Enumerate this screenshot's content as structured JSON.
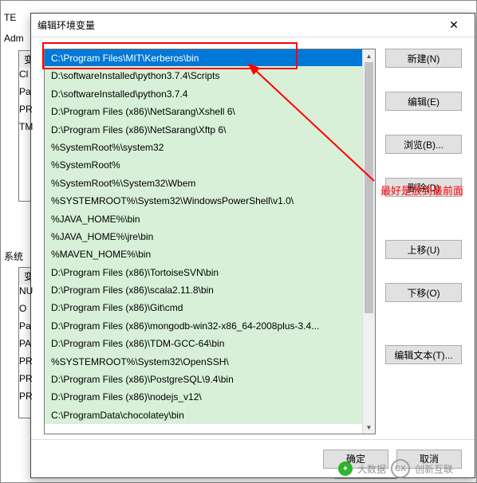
{
  "bg": {
    "label_admin": "Adm",
    "label_te": "TE",
    "label_var1": "变",
    "rows1": [
      "Cl",
      "Pa",
      "PR",
      "TM"
    ],
    "label_sys": "系统",
    "label_var2": "变",
    "rows2": [
      "NU",
      "O",
      "Pa",
      "PA",
      "PR",
      "PR",
      "PR"
    ],
    "ok": "确定"
  },
  "dialog": {
    "title": "编辑环境变量",
    "close": "✕",
    "items": [
      "C:\\Program Files\\MIT\\Kerberos\\bin",
      "D:\\softwareInstalled\\python3.7.4\\Scripts",
      "D:\\softwareInstalled\\python3.7.4",
      "D:\\Program Files (x86)\\NetSarang\\Xshell 6\\",
      "D:\\Program Files (x86)\\NetSarang\\Xftp 6\\",
      "%SystemRoot%\\system32",
      "%SystemRoot%",
      "%SystemRoot%\\System32\\Wbem",
      "%SYSTEMROOT%\\System32\\WindowsPowerShell\\v1.0\\",
      "%JAVA_HOME%\\bin",
      "%JAVA_HOME%\\jre\\bin",
      "%MAVEN_HOME%\\bin",
      "D:\\Program Files (x86)\\TortoiseSVN\\bin",
      "D:\\Program Files (x86)\\scala2.11.8\\bin",
      "D:\\Program Files (x86)\\Git\\cmd",
      "D:\\Program Files (x86)\\mongodb-win32-x86_64-2008plus-3.4...",
      "D:\\Program Files (x86)\\TDM-GCC-64\\bin",
      "%SYSTEMROOT%\\System32\\OpenSSH\\",
      "D:\\Program Files (x86)\\PostgreSQL\\9.4\\bin",
      "D:\\Program Files (x86)\\nodejs_v12\\",
      "C:\\ProgramData\\chocolatey\\bin"
    ],
    "selected_index": 0,
    "buttons": {
      "new": "新建(N)",
      "edit": "编辑(E)",
      "browse": "浏览(B)...",
      "delete": "删除(D)",
      "move_up": "上移(U)",
      "move_down": "下移(O)",
      "edit_text": "编辑文本(T)..."
    },
    "footer": {
      "ok": "确定",
      "cancel": "取消"
    }
  },
  "annotation": {
    "text": "最好是放到最前面"
  },
  "watermark": {
    "text1": "大数据",
    "text2": "创新互联"
  }
}
